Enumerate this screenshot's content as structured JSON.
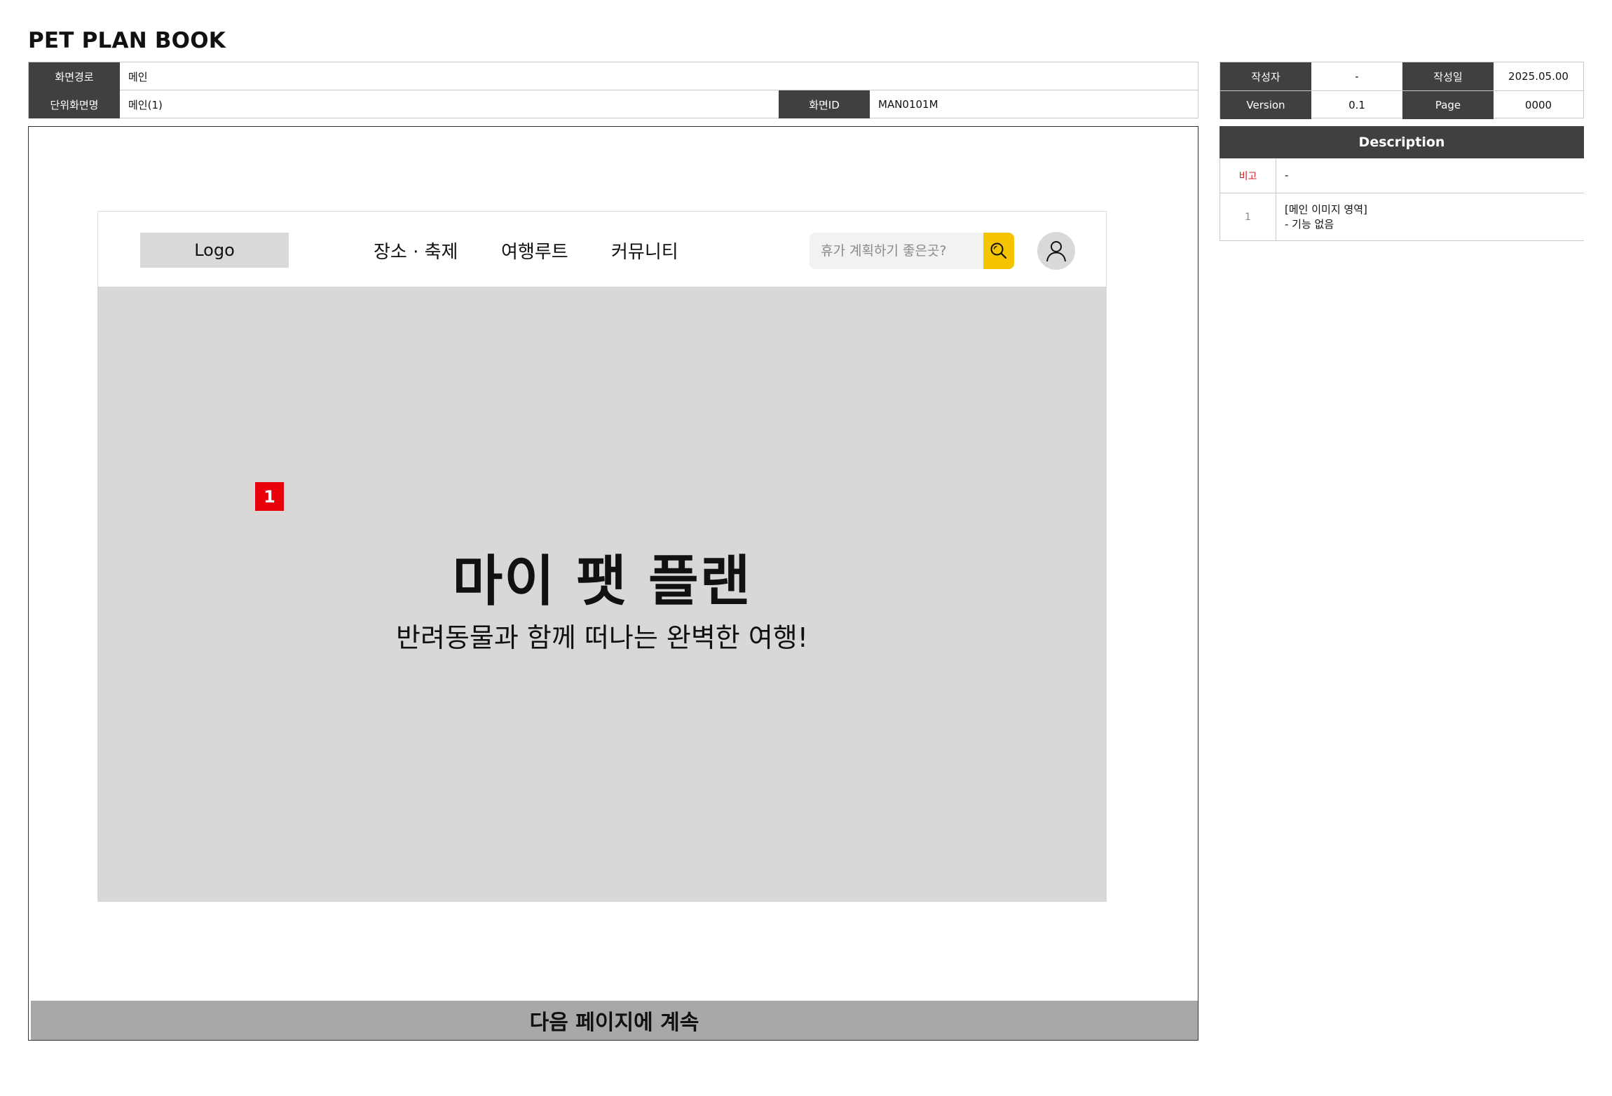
{
  "document": {
    "title": "PET PLAN BOOK"
  },
  "meta": {
    "screen_path_label": "화면경로",
    "screen_path_value": "메인",
    "unit_screen_label": "단위화면명",
    "unit_screen_value": "메인(1)",
    "screen_id_label": "화면ID",
    "screen_id_value": "MAN0101M",
    "author_label": "작성자",
    "author_value": "-",
    "date_label": "작성일",
    "date_value": "2025.05.00",
    "version_label": "Version",
    "version_value": "0.1",
    "page_label": "Page",
    "page_value": "0000"
  },
  "description": {
    "header": "Description",
    "rows": [
      {
        "num": "비고",
        "lines": [
          "-"
        ]
      },
      {
        "num": "1",
        "lines": [
          "[메인 이미지 영역]",
          "- 기능 없음"
        ]
      }
    ]
  },
  "mock": {
    "logo": "Logo",
    "nav": [
      "장소 · 축제",
      "여행루트",
      "커뮤니티"
    ],
    "search": {
      "placeholder": "휴가 계획하기 좋은곳?",
      "icon": "search-icon"
    },
    "avatar_icon": "user-icon",
    "hero": {
      "badge": "1",
      "title": "마이 팻 플랜",
      "subtitle": "반려동물과 함께 떠나는 완벽한 여행!"
    }
  },
  "footer": {
    "continue_label": "다음 페이지에 계속"
  },
  "colors": {
    "header_dark": "#404040",
    "accent_yellow": "#f5c400",
    "badge_red": "#e8000b",
    "hero_bg": "#d9d8d6",
    "continue_bar": "#a8a8a8"
  }
}
